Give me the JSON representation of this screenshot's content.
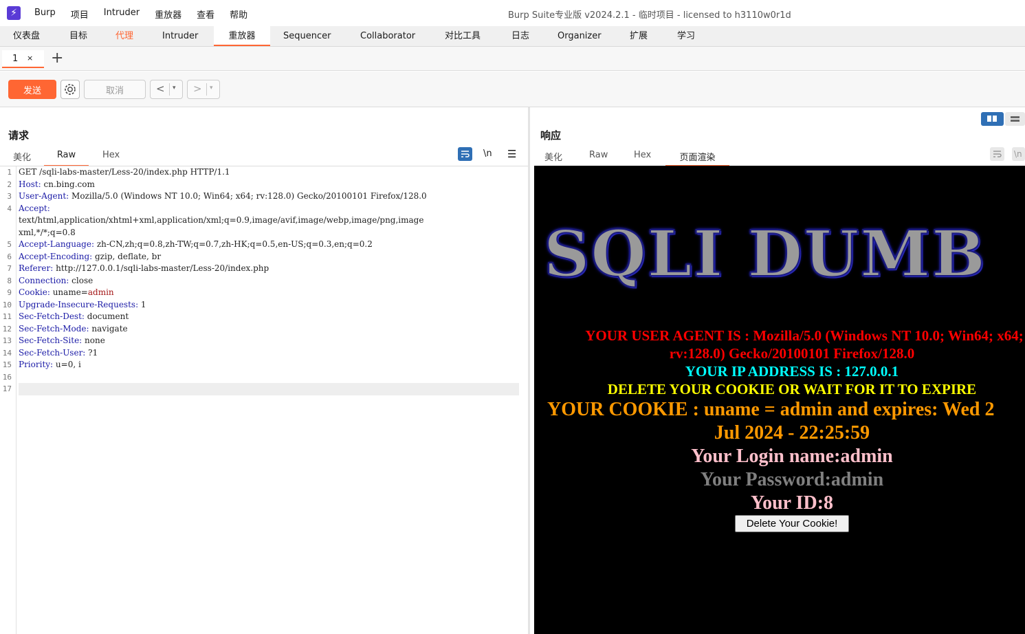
{
  "app": {
    "logo_glyph": "⚡",
    "menu": [
      "Burp",
      "项目",
      "Intruder",
      "重放器",
      "查看",
      "帮助"
    ],
    "title": "Burp Suite专业版  v2024.2.1 - 临时项目 - licensed to h3110w0r1d"
  },
  "main_tabs": [
    "仪表盘",
    "目标",
    "代理",
    "Intruder",
    "重放器",
    "Sequencer",
    "Collaborator",
    "对比工具",
    "日志",
    "Organizer",
    "扩展",
    "学习"
  ],
  "repeater_tab": {
    "label": "1",
    "close": "×",
    "add": "+"
  },
  "toolbar": {
    "send": "发送",
    "cancel": "取消",
    "back": "<",
    "forward": ">",
    "dropdown": "▾"
  },
  "request": {
    "title": "请求",
    "tabs": [
      "美化",
      "Raw",
      "Hex"
    ],
    "active_tab": "Raw",
    "icons": [
      "wrap-icon",
      "newline-icon",
      "menu-icon"
    ],
    "newline_label": "\\n",
    "lines": [
      {
        "n": "1",
        "k": "",
        "v": "GET /sqli-labs-master/Less-20/index.php HTTP/1.1"
      },
      {
        "n": "2",
        "k": "Host:",
        "v": " cn.bing.com"
      },
      {
        "n": "3",
        "k": "User-Agent:",
        "v": " Mozilla/5.0 (Windows NT 10.0; Win64; x64; rv:128.0) Gecko/20100101 Firefox/128.0"
      },
      {
        "n": "4",
        "k": "Accept:",
        "v": ""
      },
      {
        "n": "",
        "k": "",
        "v": "text/html,application/xhtml+xml,application/xml;q=0.9,image/avif,image/webp,image/png,image"
      },
      {
        "n": "",
        "k": "",
        "v": "xml,*/*;q=0.8"
      },
      {
        "n": "5",
        "k": "Accept-Language:",
        "v": " zh-CN,zh;q=0.8,zh-TW;q=0.7,zh-HK;q=0.5,en-US;q=0.3,en;q=0.2"
      },
      {
        "n": "6",
        "k": "Accept-Encoding:",
        "v": " gzip, deflate, br"
      },
      {
        "n": "7",
        "k": "Referer:",
        "v": " http://127.0.0.1/sqli-labs-master/Less-20/index.php"
      },
      {
        "n": "8",
        "k": "Connection:",
        "v": " close"
      },
      {
        "n": "9",
        "k": "Cookie:",
        "v": " uname=",
        "c": "admin"
      },
      {
        "n": "10",
        "k": "Upgrade-Insecure-Requests:",
        "v": " 1"
      },
      {
        "n": "11",
        "k": "Sec-Fetch-Dest:",
        "v": " document"
      },
      {
        "n": "12",
        "k": "Sec-Fetch-Mode:",
        "v": " navigate"
      },
      {
        "n": "13",
        "k": "Sec-Fetch-Site:",
        "v": " none"
      },
      {
        "n": "14",
        "k": "Sec-Fetch-User:",
        "v": " ?1"
      },
      {
        "n": "15",
        "k": "Priority:",
        "v": " u=0, i"
      },
      {
        "n": "16",
        "k": "",
        "v": ""
      },
      {
        "n": "17",
        "k": "",
        "v": ""
      }
    ]
  },
  "response": {
    "title": "响应",
    "tabs": [
      "美化",
      "Raw",
      "Hex",
      "页面渲染"
    ],
    "active_tab": "页面渲染",
    "render": {
      "banner": "SQLI DUMB",
      "ua_line1": "YOUR USER AGENT IS : Mozilla/5.0 (Windows NT 10.0; Win64; x64;",
      "ua_line2": "rv:128.0) Gecko/20100101 Firefox/128.0",
      "ip_line": "YOUR IP ADDRESS IS : 127.0.0.1",
      "delete_line": "DELETE YOUR COOKIE OR WAIT FOR IT TO EXPIRE",
      "cookie_line1": "YOUR COOKIE : uname = admin and expires: Wed 2",
      "cookie_line2": "Jul 2024 - 22:25:59",
      "login_line": "Your Login name:admin",
      "password_line": "Your Password:admin",
      "id_line": "Your ID:8",
      "delete_button": "Delete Your Cookie!",
      "colors": {
        "ua": "#ff0000",
        "ip": "#00ffff",
        "delete": "#ffff00",
        "cookie": "#ff9900",
        "login": "#ffc0cb",
        "password": "#808080",
        "id": "#ffc0cb"
      }
    }
  }
}
